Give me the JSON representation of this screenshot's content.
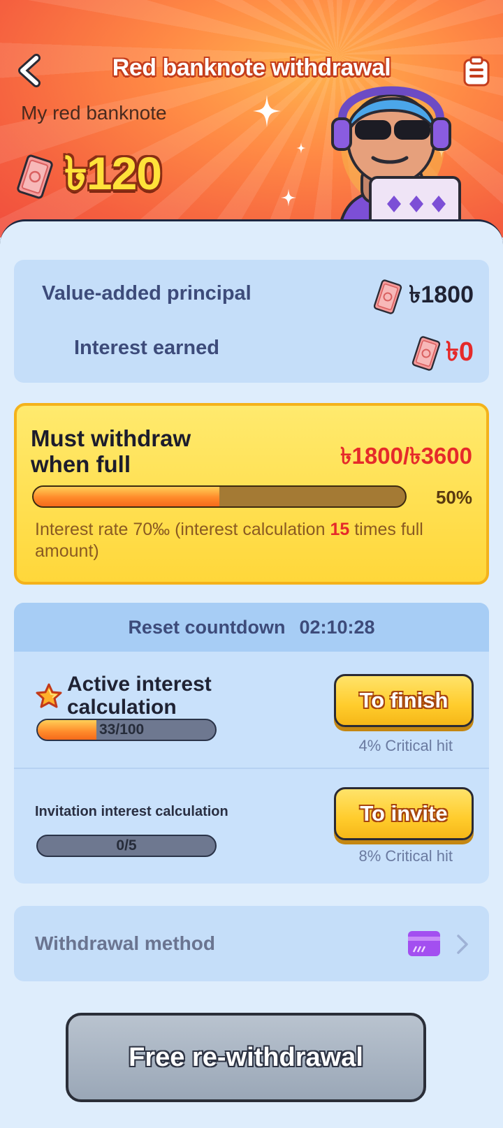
{
  "header": {
    "title": "Red banknote withdrawal",
    "my_label": "My red banknote",
    "balance": "৳120"
  },
  "summary": {
    "principal_label": "Value-added principal",
    "principal_value": "৳1800",
    "interest_label": "Interest earned",
    "interest_value": "৳0"
  },
  "must_withdraw": {
    "title": "Must withdraw when full",
    "value": "৳1800/৳3600",
    "progress_fraction": 0.5,
    "progress_label": "50%",
    "rate_prefix": "Interest rate 70‰ (interest calculation ",
    "rate_times": "15",
    "rate_suffix": " times full amount)"
  },
  "tasks": {
    "reset_label": "Reset countdown",
    "reset_time": "02:10:28",
    "active": {
      "title": "Active interest calculation",
      "progress_text": "33/100",
      "progress_fraction": 0.33,
      "button": "To finish",
      "critical": "4% Critical hit"
    },
    "invite": {
      "title": "Invitation interest calculation",
      "progress_text": "0/5",
      "progress_fraction": 0,
      "button": "To invite",
      "critical": "8% Critical hit"
    }
  },
  "method": {
    "label": "Withdrawal method"
  },
  "footer": {
    "button": "Free re-withdrawal"
  },
  "colors": {
    "accent_red": "#e52a2a",
    "banknote": "#f27d7d",
    "yellow": "#ffd73a"
  },
  "icons": [
    "back-arrow-icon",
    "clipboard-icon",
    "banknote-icon",
    "star-icon",
    "card-icon",
    "chevron-right-icon",
    "sparkle-icon"
  ]
}
